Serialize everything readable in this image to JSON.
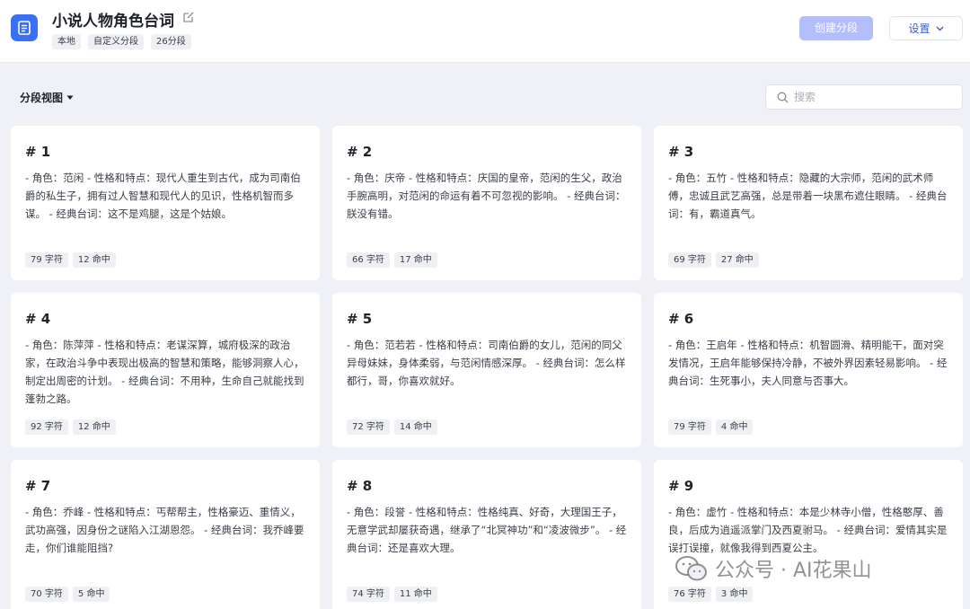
{
  "header": {
    "title": "小说人物角色台词",
    "tags": [
      "本地",
      "自定义分段",
      "26分段"
    ],
    "create_label": "创建分段",
    "settings_label": "设置"
  },
  "toolbar": {
    "view_label": "分段视图",
    "search_placeholder": "搜索"
  },
  "cards": [
    {
      "num": "# 1",
      "text": "- 角色：范闲 - 性格和特点：现代人重生到古代，成为司南伯爵的私生子，拥有过人智慧和现代人的见识，性格机智而多谋。 - 经典台词：这不是鸡腿，这是个姑娘。",
      "chars": "79 字符",
      "hits": "12 命中"
    },
    {
      "num": "# 2",
      "text": "- 角色：庆帝 - 性格和特点：庆国的皇帝，范闲的生父，政治手腕高明，对范闲的命运有着不可忽视的影响。 - 经典台词：朕没有错。",
      "chars": "66 字符",
      "hits": "17 命中"
    },
    {
      "num": "# 3",
      "text": "- 角色：五竹 - 性格和特点：隐藏的大宗师，范闲的武术师傅，忠诚且武艺高强，总是带着一块黑布遮住眼睛。 - 经典台词：有，霸道真气。",
      "chars": "69 字符",
      "hits": "27 命中"
    },
    {
      "num": "# 4",
      "text": "- 角色：陈萍萍 - 性格和特点：老谋深算，城府极深的政治家，在政治斗争中表现出极高的智慧和策略，能够洞察人心，制定出周密的计划。 - 经典台词：不用种，生命自己就能找到蓬勃之路。",
      "chars": "92 字符",
      "hits": "12 命中"
    },
    {
      "num": "# 5",
      "text": "- 角色：范若若 - 性格和特点：司南伯爵的女儿，范闲的同父异母妹妹，身体柔弱，与范闲情感深厚。 - 经典台词：怎么样都行，哥，你喜欢就好。",
      "chars": "72 字符",
      "hits": "14 命中"
    },
    {
      "num": "# 6",
      "text": "- 角色：王启年 - 性格和特点：机智圆滑、精明能干，面对突发情况，王启年能够保持冷静，不被外界因素轻易影响。 - 经典台词：生死事小，夫人同意与否事大。",
      "chars": "79 字符",
      "hits": "4 命中"
    },
    {
      "num": "# 7",
      "text": "- 角色：乔峰 - 性格和特点：丐帮帮主，性格豪迈、重情义，武功高强，因身份之谜陷入江湖恩怨。 - 经典台词：我乔峰要走，你们谁能阻挡?",
      "chars": "70 字符",
      "hits": "5 命中"
    },
    {
      "num": "# 8",
      "text": "- 角色：段誉 - 性格和特点：性格纯真、好奇，大理国王子，无意学武却屡获奇遇，继承了“北冥神功”和“凌波微步”。 - 经典台词：还是喜欢大理。",
      "chars": "74 字符",
      "hits": "11 命中"
    },
    {
      "num": "# 9",
      "text": "- 角色：虚竹 - 性格和特点：本是少林寺小僧，性格憨厚、善良，后成为逍遥派掌门及西夏驸马。 - 经典台词：爱情其实是误打误撞，就像我得到西夏公主。",
      "chars": "76 字符",
      "hits": "3 命中"
    }
  ],
  "watermark": "公众号 · AI花果山",
  "colors": {
    "accent": "#3b6ff5",
    "button_disabled": "#b3befa",
    "background": "#eff1f6"
  }
}
